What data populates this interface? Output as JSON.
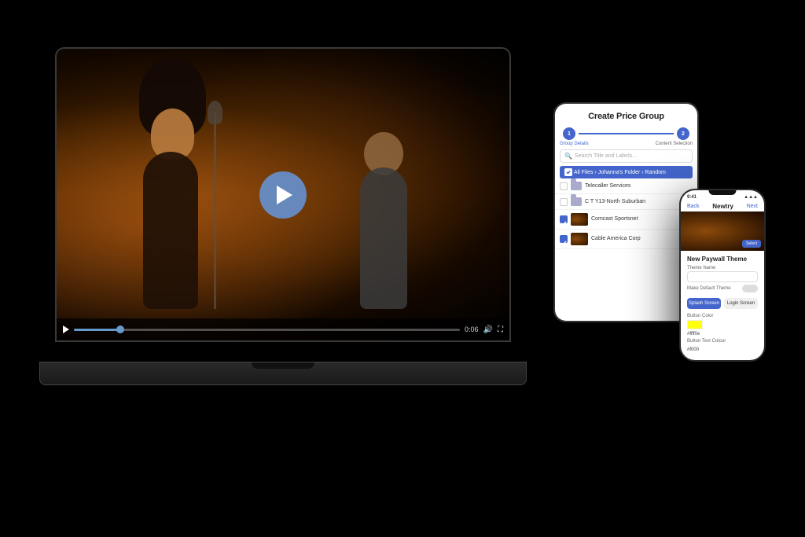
{
  "scene": {
    "bg_color": "#000000"
  },
  "laptop": {
    "video": {
      "play_btn_label": "Play",
      "time_current": "0:06",
      "time_total": "0:06",
      "progress_percent": 12
    }
  },
  "tablet": {
    "title": "Create Price Group",
    "stepper": {
      "step1_label": "Group Details",
      "step2_label": "Content Selection",
      "step1_active": true
    },
    "search_placeholder": "Search Title and Labels...",
    "breadcrumb": "All Files › Johanna's Folder › Random",
    "rows": [
      {
        "type": "folder",
        "label": "Telecaller Services",
        "checked": false
      },
      {
        "type": "folder",
        "label": "C T Y13-North Suburban",
        "checked": false
      },
      {
        "type": "video",
        "label": "Comcast Sportsnet",
        "checked": true
      },
      {
        "type": "video",
        "label": "Cable America Corp",
        "checked": true
      }
    ]
  },
  "phone": {
    "status_time": "9:41",
    "status_icons": "●●●",
    "header": {
      "back": "Back",
      "title": "Newtry",
      "action": "Next"
    },
    "section_title": "New Paywall Theme",
    "form": {
      "theme_name_label": "Theme Name",
      "theme_name_value": "",
      "default_theme_label": "Make Default Theme",
      "toggle_state": false,
      "splash_btn": "Splash Screen",
      "login_btn": "Login Screen",
      "button_color_label": "Button Color",
      "button_color_value": "#ffff0e",
      "button_color_hex": "#ffff0e",
      "button_text_color_label": "Button Text Colour",
      "button_text_color_value": "#f000"
    }
  }
}
